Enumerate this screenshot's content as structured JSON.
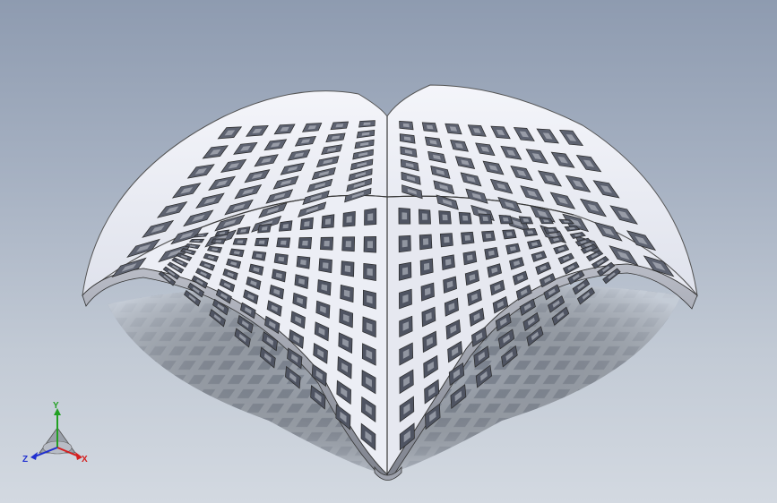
{
  "viewport": {
    "background_top": "#8e9bb0",
    "background_bottom": "#d3d9e1",
    "model_color": "#e9ebf3",
    "model_edge_color": "#2a2a2a",
    "shadow_color": "#6f7787"
  },
  "model": {
    "name": "perforated-shell-canopy",
    "hole_pattern": "square-grid"
  },
  "triad": {
    "x_label": "X",
    "y_label": "Y",
    "z_label": "Z",
    "x_color": "#d42020",
    "y_color": "#22a022",
    "z_color": "#2030d0"
  }
}
